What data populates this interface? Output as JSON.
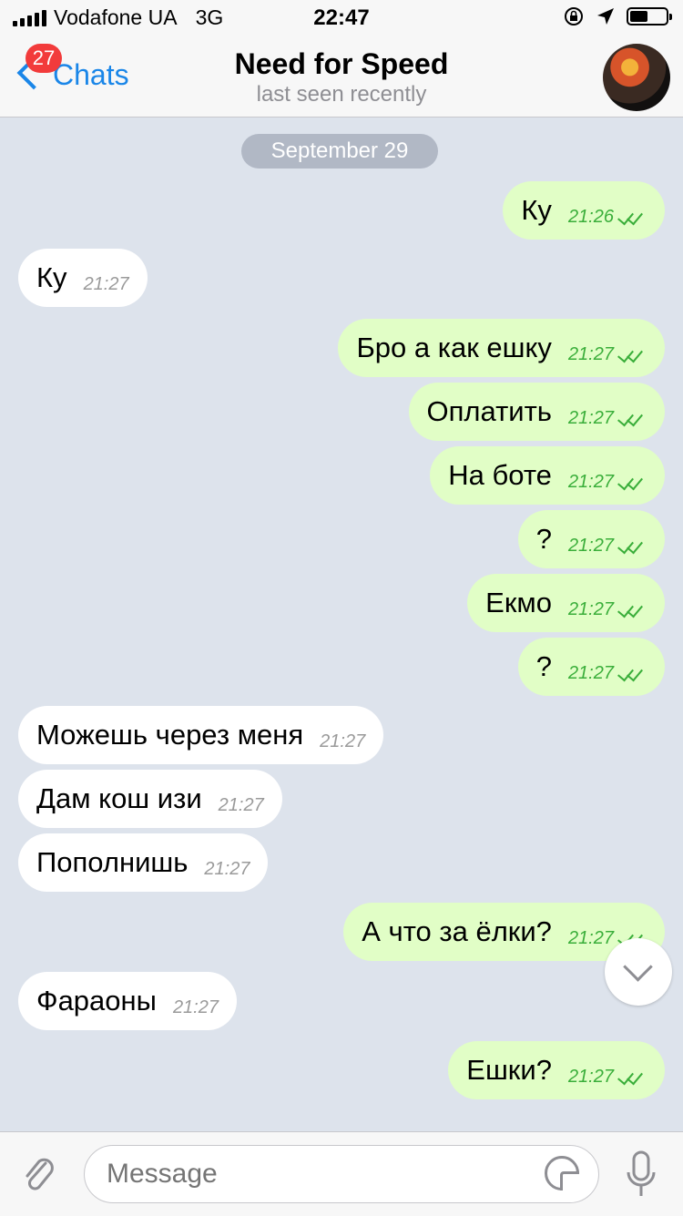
{
  "status_bar": {
    "carrier": "Vodafone UA",
    "network": "3G",
    "time": "22:47",
    "battery_level": 0.5
  },
  "header": {
    "back_label": "Chats",
    "unread_badge": "27",
    "title": "Need for Speed",
    "subtitle": "last seen recently"
  },
  "chat": {
    "date_label": "September 29",
    "messages": [
      {
        "dir": "out",
        "text": "Ку",
        "time": "21:26",
        "read": true
      },
      {
        "dir": "in",
        "text": "Ку",
        "time": "21:27"
      },
      {
        "dir": "out",
        "text": "Бро а как ешку",
        "time": "21:27",
        "read": true
      },
      {
        "dir": "out",
        "text": "Оплатить",
        "time": "21:27",
        "read": true
      },
      {
        "dir": "out",
        "text": "На боте",
        "time": "21:27",
        "read": true
      },
      {
        "dir": "out",
        "text": "?",
        "time": "21:27",
        "read": true
      },
      {
        "dir": "out",
        "text": "Екмо",
        "time": "21:27",
        "read": true
      },
      {
        "dir": "out",
        "text": "?",
        "time": "21:27",
        "read": true
      },
      {
        "dir": "in",
        "text": "Можешь через меня",
        "time": "21:27"
      },
      {
        "dir": "in",
        "text": "Дам кош изи",
        "time": "21:27"
      },
      {
        "dir": "in",
        "text": "Пополнишь",
        "time": "21:27"
      },
      {
        "dir": "out",
        "text": "А что за ёлки?",
        "time": "21:27",
        "read": true
      },
      {
        "dir": "in",
        "text": "Фараоны",
        "time": "21:27"
      },
      {
        "dir": "out",
        "text": "Ешки?",
        "time": "21:27",
        "read": true
      }
    ]
  },
  "input": {
    "placeholder": "Message"
  },
  "icons": {
    "signal": "signal-bars-icon",
    "lock": "rotation-lock-icon",
    "location": "location-arrow-icon",
    "battery": "battery-icon",
    "back": "chevron-left-icon",
    "scroll": "chevron-down-icon",
    "attach": "paperclip-icon",
    "sticker": "sticker-icon",
    "mic": "microphone-icon"
  },
  "colors": {
    "accent": "#1a86e8",
    "outgoing_bubble": "#e1fec6",
    "incoming_bubble": "#ffffff",
    "check_color": "#3aae3a",
    "badge": "#f23b3b",
    "chat_background": "#dde3ec"
  }
}
